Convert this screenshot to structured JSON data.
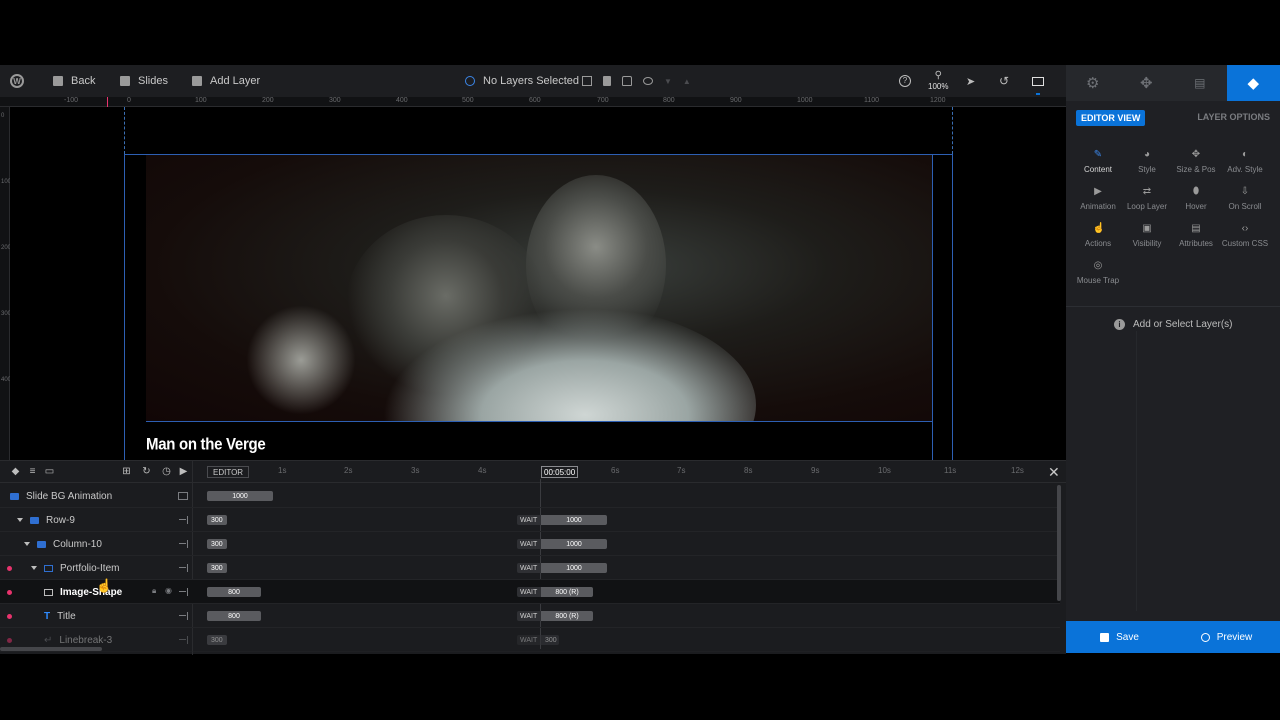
{
  "toolbar": {
    "back_label": "Back",
    "slides_label": "Slides",
    "add_layer_label": "Add Layer",
    "selection_status": "No Layers Selected",
    "zoom_level": "100%"
  },
  "panel": {
    "editor_view_label": "EDITOR VIEW",
    "layer_options_label": "LAYER OPTIONS",
    "options": [
      {
        "label": "Content",
        "icon": "pencil-icon"
      },
      {
        "label": "Style",
        "icon": "palette-icon"
      },
      {
        "label": "Size & Pos",
        "icon": "move-icon"
      },
      {
        "label": "Adv. Style",
        "icon": "contrast-icon"
      },
      {
        "label": "Animation",
        "icon": "play-icon"
      },
      {
        "label": "Loop Layer",
        "icon": "loop-icon"
      },
      {
        "label": "Hover",
        "icon": "mouse-icon"
      },
      {
        "label": "On Scroll",
        "icon": "scroll-icon"
      },
      {
        "label": "Actions",
        "icon": "pointer-icon"
      },
      {
        "label": "Visibility",
        "icon": "visibility-icon"
      },
      {
        "label": "Attributes",
        "icon": "document-icon"
      },
      {
        "label": "Custom CSS",
        "icon": "code-icon"
      },
      {
        "label": "Mouse Trap",
        "icon": "target-icon"
      }
    ],
    "empty_message": "Add or Select Layer(s)"
  },
  "footer": {
    "save_label": "Save",
    "preview_label": "Preview"
  },
  "ruler": {
    "top_ticks": [
      "-100",
      "0",
      "100",
      "200",
      "300",
      "400",
      "500",
      "600",
      "700",
      "800",
      "900",
      "1000",
      "1100",
      "1200"
    ],
    "left_ticks": [
      "0",
      "100",
      "200",
      "300",
      "400"
    ]
  },
  "canvas": {
    "slide_title": "Man on the Verge"
  },
  "timeline": {
    "editor_label": "EDITOR",
    "ticks": [
      "1s",
      "2s",
      "3s",
      "4s",
      "6s",
      "7s",
      "8s",
      "9s",
      "10s",
      "11s",
      "12s"
    ],
    "current_time": "00:05:00",
    "wait_label": "WAIT",
    "rows": [
      {
        "name": "Slide BG Animation",
        "start": "1000",
        "end": ""
      },
      {
        "name": "Row-9",
        "start": "300",
        "end": "1000"
      },
      {
        "name": "Column-10",
        "start": "300",
        "end": "1000"
      },
      {
        "name": "Portfolio-Item",
        "start": "300",
        "end": "1000"
      },
      {
        "name": "Image-Shape",
        "start": "800",
        "end": "800 (R)"
      },
      {
        "name": "Title",
        "start": "800",
        "end": "800 (R)"
      },
      {
        "name": "Linebreak-3",
        "start": "300",
        "end": "300"
      }
    ]
  },
  "colors": {
    "accent": "#0a73d9",
    "layer_marker": "#e8336d",
    "canvas_guide": "#2d5fb3"
  }
}
